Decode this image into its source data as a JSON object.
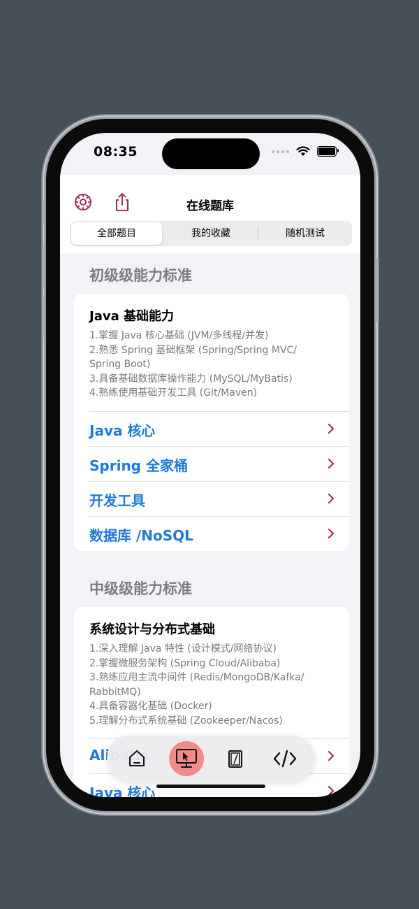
{
  "status_bar": {
    "time": "08:35"
  },
  "nav": {
    "title": "在线题库",
    "settings_icon": "gear-icon",
    "share_icon": "share-icon"
  },
  "segments": [
    {
      "label": "全部题目",
      "active": true
    },
    {
      "label": "我的收藏",
      "active": false
    },
    {
      "label": "随机测试",
      "active": false
    }
  ],
  "sections": [
    {
      "header": "初级级能力标准",
      "card": {
        "title": "Java 基础能力",
        "description": "1.掌握 Java 核心基础 (JVM/多线程/并发)\n2.熟悉 Spring 基础框架 (Spring/Spring MVC/\nSpring Boot)\n3.具备基础数据库操作能力 (MySQL/MyBatis)\n4.熟练使用基础开发工具 (Git/Maven)",
        "rows": [
          "Java 核心",
          "Spring 全家桶",
          "开发工具",
          "数据库 /NoSQL"
        ]
      }
    },
    {
      "header": "中级级能力标准",
      "card": {
        "title": "系统设计与分布式基础",
        "description": "1.深入理解 Java 特性 (设计模式/网络协议)\n2.掌握微服务架构 (Spring Cloud/Alibaba)\n3.熟练应用主流中间件 (Redis/MongoDB/Kafka/\nRabbitMQ)\n4.具备容器化基础 (Docker)\n5.理解分布式系统基础 (Zookeeper/Nacos)",
        "rows": [
          "Alibaba",
          "Java 核心"
        ]
      }
    }
  ],
  "tabbar": {
    "items": [
      {
        "icon": "home-icon",
        "active": false
      },
      {
        "icon": "desktop-pointer-icon",
        "active": true
      },
      {
        "icon": "notes-icon",
        "active": false
      },
      {
        "icon": "code-icon",
        "active": false
      }
    ]
  },
  "colors": {
    "accent": "#1e7ad9",
    "chevron": "#a3324e",
    "icon_tint": "#a3324e",
    "active_tab": "#f08b86",
    "section_header": "#7c7c80"
  }
}
